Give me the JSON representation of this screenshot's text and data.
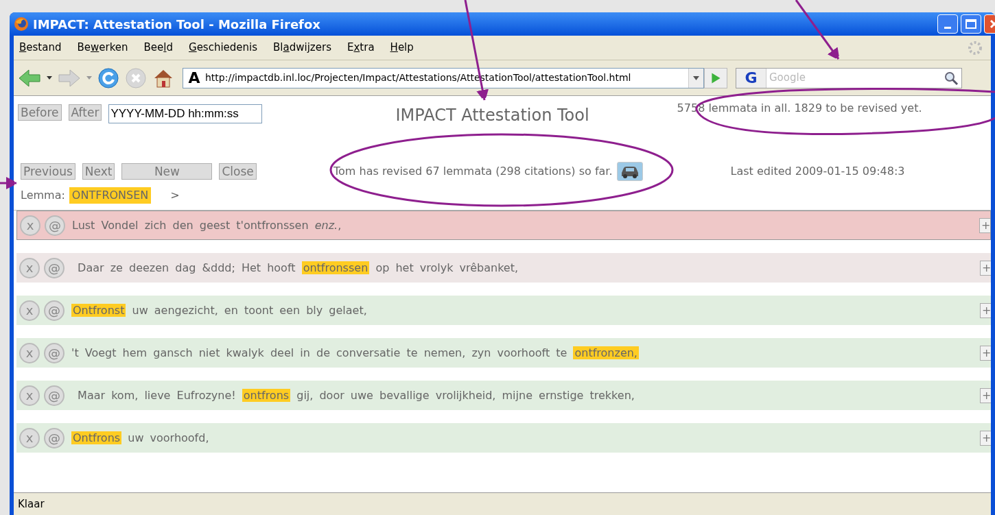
{
  "window": {
    "title": "IMPACT: Attestation Tool - Mozilla Firefox"
  },
  "menu": [
    {
      "key": "B",
      "after": "estand"
    },
    {
      "before": "Be",
      "key": "w",
      "after": "erken"
    },
    {
      "before": "Bee",
      "key": "l",
      "after": "d"
    },
    {
      "key": "G",
      "after": "eschiedenis"
    },
    {
      "before": "Bl",
      "key": "a",
      "after": "dwijzers"
    },
    {
      "before": "E",
      "key": "x",
      "after": "tra"
    },
    {
      "key": "H",
      "after": "elp"
    }
  ],
  "toolbar": {
    "site_glyph": "A",
    "url": "http://impactdb.inl.loc/Projecten/Impact/Attestations/AttestationTool/attestationTool.html",
    "engine_glyph": "G",
    "search_placeholder": "Google"
  },
  "page": {
    "time_buttons": [
      "Before",
      "After"
    ],
    "time_value": "YYYY-MM-DD hh:mm:ss",
    "title": "IMPACT Attestation Tool",
    "totals": "5758 lemmata in all. 1829 to be revised yet.",
    "nav_buttons": [
      {
        "label": "Previous",
        "kind": "narrow"
      },
      {
        "label": "Next",
        "kind": "narrow"
      },
      {
        "label": "New",
        "kind": "wide"
      },
      {
        "label": "Close",
        "kind": "narrow"
      }
    ],
    "progress": "Tom has revised 67 lemmata (298 citations) so far.",
    "last_edited": "Last edited 2009-01-15 09:48:3",
    "lemma_label": "Lemma:",
    "lemma": "ONTFRONSEN",
    "next_lemma": ">",
    "citations": [
      {
        "color": "#efc8c8",
        "selected": true,
        "buttons": [
          "x",
          "@"
        ],
        "expand": "+",
        "segments": [
          {
            "text": "Lust Vondel zich den geest t'ontfronssen *enz.*,",
            "highlight": false
          }
        ]
      },
      {
        "color": "#eee6e6",
        "selected": false,
        "buttons": [
          "x",
          "@"
        ],
        "expand": "+",
        "segments": [
          {
            "text": " Daar ze deezen dag &ddd; Het hooft",
            "highlight": false
          },
          {
            "text": "ontfronssen",
            "highlight": true
          },
          {
            "text": "op het vrolyk vrêbanket,",
            "highlight": false
          }
        ]
      },
      {
        "color": "#e1eee0",
        "selected": false,
        "buttons": [
          "x",
          "@"
        ],
        "expand": "+",
        "segments": [
          {
            "text": "Ontfronst",
            "highlight": true
          },
          {
            "text": "uw aengezicht, en toont een bly gelaet,",
            "highlight": false
          }
        ]
      },
      {
        "color": "#e1eee0",
        "selected": false,
        "buttons": [
          "x",
          "@"
        ],
        "expand": "+",
        "segments": [
          {
            "text": "'t Voegt hem gansch niet kwalyk deel in de conversatie te nemen, zyn voorhooft te",
            "highlight": false
          },
          {
            "text": "ontfronzen,",
            "highlight": true
          }
        ]
      },
      {
        "color": "#e1eee0",
        "selected": false,
        "buttons": [
          "x",
          "@"
        ],
        "expand": "+",
        "segments": [
          {
            "text": " Maar kom, lieve Eufrozyne!",
            "highlight": false
          },
          {
            "text": "ontfrons",
            "highlight": true
          },
          {
            "text": "gij, door uwe bevallige vrolijkheid, mijne ernstige trekken,",
            "highlight": false
          }
        ]
      },
      {
        "color": "#e1eee0",
        "selected": false,
        "buttons": [
          "x",
          "@"
        ],
        "expand": "+",
        "segments": [
          {
            "text": "Ontfrons",
            "highlight": true
          },
          {
            "text": "uw voorhoofd,",
            "highlight": false
          }
        ]
      }
    ]
  },
  "status_bar": "Klaar"
}
